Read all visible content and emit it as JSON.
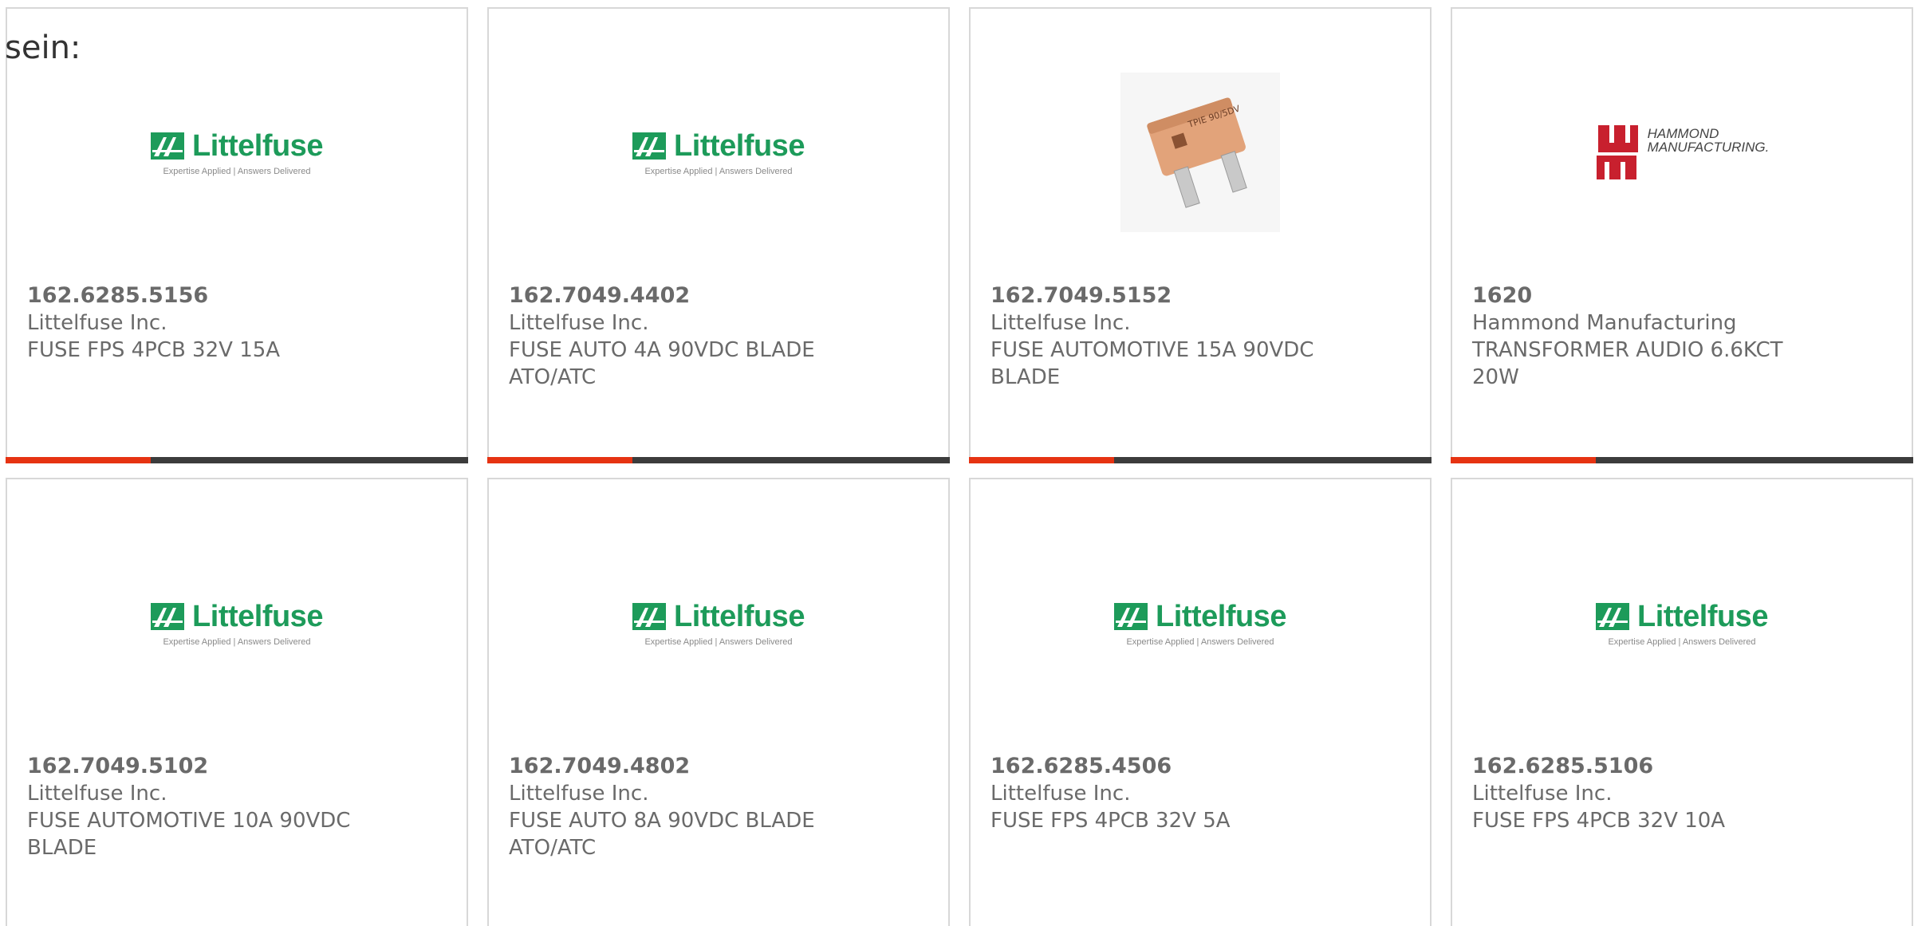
{
  "intro_text": "sein:",
  "brand_logos": {
    "littelfuse_name": "Littelfuse",
    "littelfuse_tagline": "Expertise Applied | Answers Delivered",
    "hammond_line1": "HAMMOND",
    "hammond_line2": "MANUFACTURING."
  },
  "product_image_icon": "blade-fuse-photo",
  "colors": {
    "accent": "#e63312",
    "bar_dark": "#3c3c3c",
    "littelfuse_green": "#1d9b5a",
    "hammond_red": "#c8202e",
    "card_border": "#d8d8d8",
    "text_gray": "#6a6a6a"
  },
  "products": [
    {
      "part": "162.6285.5156",
      "maker": "Littelfuse Inc.",
      "desc": "FUSE FPS 4PCB 32V 15A",
      "logo": "littelfuse"
    },
    {
      "part": "162.7049.4402",
      "maker": "Littelfuse Inc.",
      "desc": "FUSE AUTO 4A 90VDC BLADE ATO/ATC",
      "logo": "littelfuse"
    },
    {
      "part": "162.7049.5152",
      "maker": "Littelfuse Inc.",
      "desc": "FUSE AUTOMOTIVE 15A 90VDC BLADE",
      "logo": "photo"
    },
    {
      "part": "1620",
      "maker": "Hammond Manufacturing",
      "desc": "TRANSFORMER AUDIO 6.6KCT 20W",
      "logo": "hammond"
    },
    {
      "part": "162.7049.5102",
      "maker": "Littelfuse Inc.",
      "desc": "FUSE AUTOMOTIVE 10A 90VDC BLADE",
      "logo": "littelfuse"
    },
    {
      "part": "162.7049.4802",
      "maker": "Littelfuse Inc.",
      "desc": "FUSE AUTO 8A 90VDC BLADE ATO/ATC",
      "logo": "littelfuse"
    },
    {
      "part": "162.6285.4506",
      "maker": "Littelfuse Inc.",
      "desc": "FUSE FPS 4PCB 32V 5A",
      "logo": "littelfuse"
    },
    {
      "part": "162.6285.5106",
      "maker": "Littelfuse Inc.",
      "desc": "FUSE FPS 4PCB 32V 10A",
      "logo": "littelfuse"
    }
  ]
}
